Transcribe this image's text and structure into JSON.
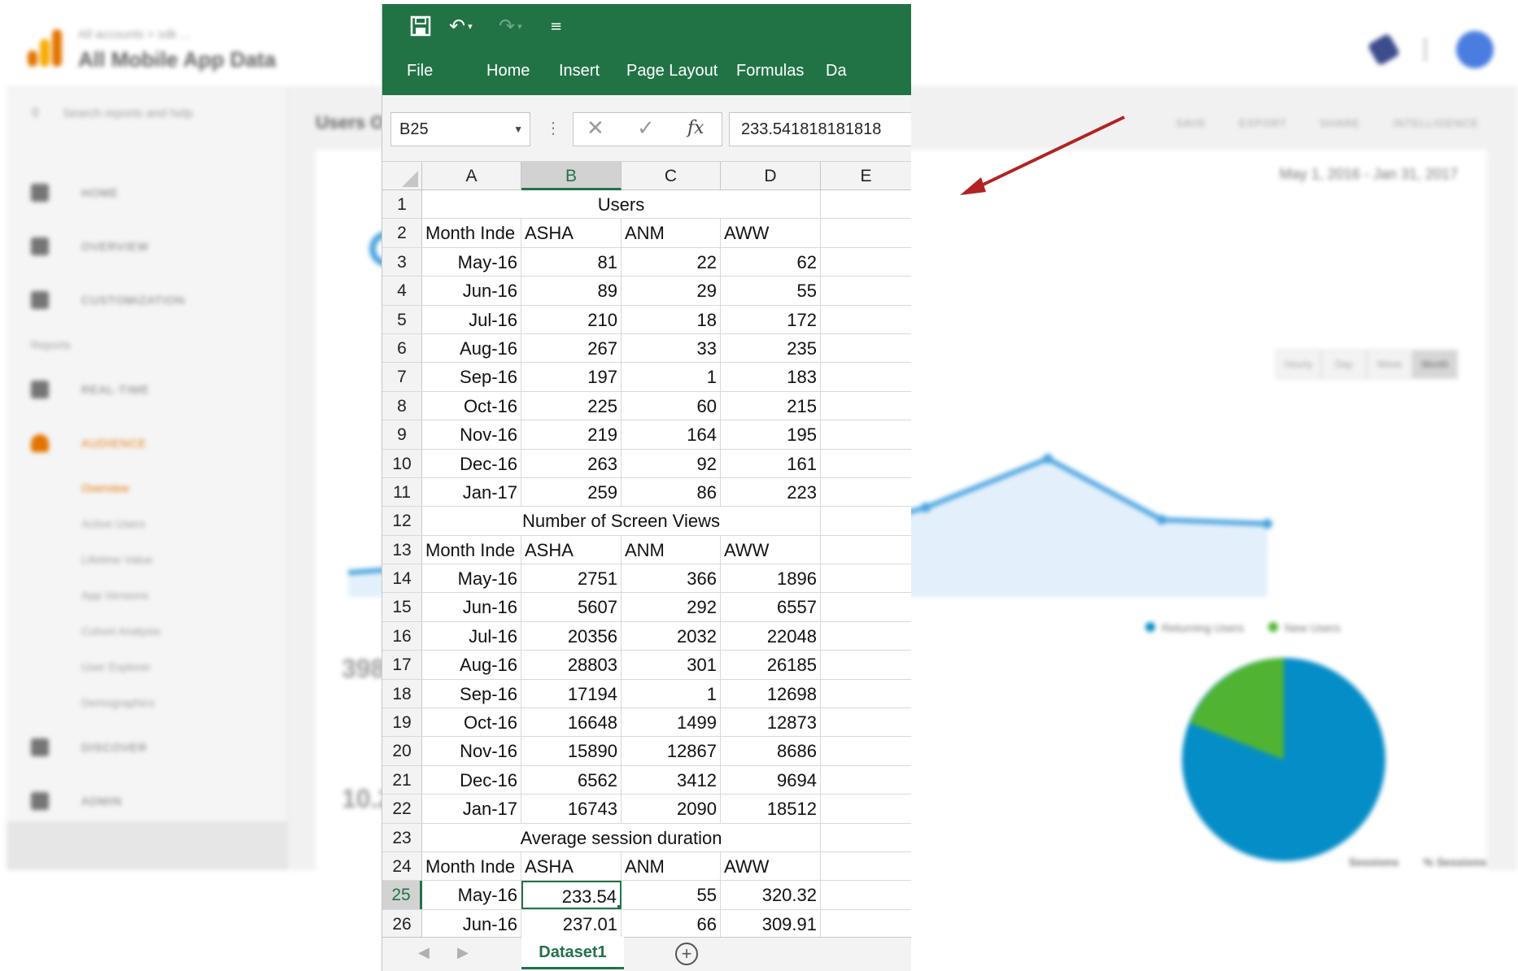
{
  "background_app": {
    "breadcrumb": "All accounts > sdk ...",
    "property_name": "All Mobile App Data",
    "search_placeholder": "Search reports and help",
    "nav": [
      {
        "label": "HOME",
        "icon": "home-icon"
      },
      {
        "label": "OVERVIEW",
        "icon": "home-icon"
      },
      {
        "label": "CUSTOMIZATION",
        "icon": "grid-icon"
      },
      {
        "label": "Reports",
        "icon": ""
      },
      {
        "label": "REAL-TIME",
        "icon": "clock-icon"
      },
      {
        "label": "AUDIENCE",
        "icon": "person-icon"
      }
    ],
    "audience_sub": [
      "Overview",
      "Active Users",
      "Lifetime Value",
      "App Versions",
      "Cohort Analysis",
      "User Explorer",
      "Demographics"
    ],
    "nav_bottom": [
      {
        "label": "DISCOVER",
        "icon": "bulb-icon"
      },
      {
        "label": "ADMIN",
        "icon": "gear-icon"
      }
    ],
    "page_title": "Users O",
    "actions": [
      "SAVE",
      "EXPORT",
      "SHARE",
      "INTELLIGENCE"
    ],
    "date_range": "May 1, 2016 - Jan 31, 2017",
    "range_buttons": [
      "Hourly",
      "Day",
      "Week",
      "Month"
    ],
    "range_selected": "Month",
    "kpi_users": "398",
    "kpi_screens": "10.2",
    "legend": [
      {
        "label": "Returning Users",
        "color": "#058dc7"
      },
      {
        "label": "New Users",
        "color": "#50b432"
      }
    ],
    "pie": {
      "returning": 81.1,
      "new": 18.9
    },
    "table_headers": [
      "Sessions",
      "% Sessions"
    ]
  },
  "excel": {
    "accent_color": "#217346",
    "quick_access": {
      "save_icon": "save-icon",
      "undo_icon": "undo-icon",
      "redo_icon": "redo-icon",
      "customize_icon": "customize-qat-icon"
    },
    "ribbon_tabs": [
      "File",
      "Home",
      "Insert",
      "Page Layout",
      "Formulas",
      "Da"
    ],
    "name_box": "B25",
    "fx_label": "fx",
    "formula_value": "233.541818181818",
    "columns": [
      "A",
      "B",
      "C",
      "D",
      "E"
    ],
    "selected_column": "B",
    "selected_row": "25",
    "rows": [
      {
        "n": "1",
        "merged": "Users"
      },
      {
        "n": "2",
        "a": "Month Inde",
        "b": "ASHA",
        "c": "ANM",
        "d": "AWW",
        "hdr": true
      },
      {
        "n": "3",
        "a": "May-16",
        "b": "81",
        "c": "22",
        "d": "62"
      },
      {
        "n": "4",
        "a": "Jun-16",
        "b": "89",
        "c": "29",
        "d": "55"
      },
      {
        "n": "5",
        "a": "Jul-16",
        "b": "210",
        "c": "18",
        "d": "172"
      },
      {
        "n": "6",
        "a": "Aug-16",
        "b": "267",
        "c": "33",
        "d": "235"
      },
      {
        "n": "7",
        "a": "Sep-16",
        "b": "197",
        "c": "1",
        "d": "183"
      },
      {
        "n": "8",
        "a": "Oct-16",
        "b": "225",
        "c": "60",
        "d": "215"
      },
      {
        "n": "9",
        "a": "Nov-16",
        "b": "219",
        "c": "164",
        "d": "195"
      },
      {
        "n": "10",
        "a": "Dec-16",
        "b": "263",
        "c": "92",
        "d": "161"
      },
      {
        "n": "11",
        "a": "Jan-17",
        "b": "259",
        "c": "86",
        "d": "223"
      },
      {
        "n": "12",
        "merged": "Number of Screen Views"
      },
      {
        "n": "13",
        "a": "Month Inde",
        "b": "ASHA",
        "c": "ANM",
        "d": "AWW",
        "hdr": true
      },
      {
        "n": "14",
        "a": "May-16",
        "b": "2751",
        "c": "366",
        "d": "1896"
      },
      {
        "n": "15",
        "a": "Jun-16",
        "b": "5607",
        "c": "292",
        "d": "6557"
      },
      {
        "n": "16",
        "a": "Jul-16",
        "b": "20356",
        "c": "2032",
        "d": "22048"
      },
      {
        "n": "17",
        "a": "Aug-16",
        "b": "28803",
        "c": "301",
        "d": "26185"
      },
      {
        "n": "18",
        "a": "Sep-16",
        "b": "17194",
        "c": "1",
        "d": "12698"
      },
      {
        "n": "19",
        "a": "Oct-16",
        "b": "16648",
        "c": "1499",
        "d": "12873"
      },
      {
        "n": "20",
        "a": "Nov-16",
        "b": "15890",
        "c": "12867",
        "d": "8686"
      },
      {
        "n": "21",
        "a": "Dec-16",
        "b": "6562",
        "c": "3412",
        "d": "9694"
      },
      {
        "n": "22",
        "a": "Jan-17",
        "b": "16743",
        "c": "2090",
        "d": "18512"
      },
      {
        "n": "23",
        "merged": "Average session duration"
      },
      {
        "n": "24",
        "a": "Month Inde",
        "b": "ASHA",
        "c": "ANM",
        "d": "AWW",
        "hdr": true
      },
      {
        "n": "25",
        "a": "May-16",
        "b": "233.54",
        "c": "55",
        "d": "320.32",
        "active": "b"
      },
      {
        "n": "26",
        "a": "Jun-16",
        "b": "237.01",
        "c": "66",
        "d": "309.91"
      }
    ],
    "sheet_tab": "Dataset1",
    "add_sheet": "+"
  },
  "annotation_arrow": {
    "color": "#b22222"
  }
}
